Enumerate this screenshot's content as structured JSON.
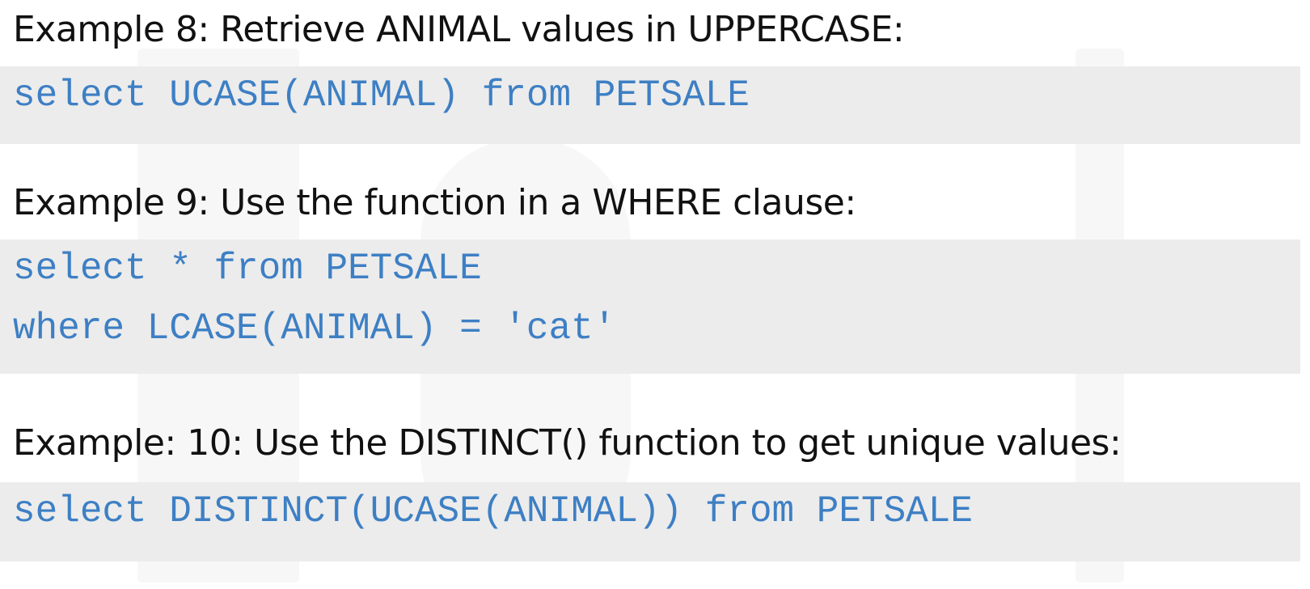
{
  "examples": [
    {
      "heading": "Example 8: Retrieve ANIMAL values in UPPERCASE:",
      "code": [
        "select UCASE(ANIMAL) from PETSALE"
      ]
    },
    {
      "heading": "Example 9: Use the function in a WHERE clause:",
      "code": [
        "select * from PETSALE",
        "where LCASE(ANIMAL) = 'cat'"
      ]
    },
    {
      "heading": "Example: 10: Use the DISTINCT() function to get unique values:",
      "code": [
        "select DISTINCT(UCASE(ANIMAL)) from PETSALE"
      ]
    }
  ],
  "colors": {
    "code_text": "#3d7fc4",
    "code_background": "#ececec",
    "heading_text": "#111111"
  }
}
